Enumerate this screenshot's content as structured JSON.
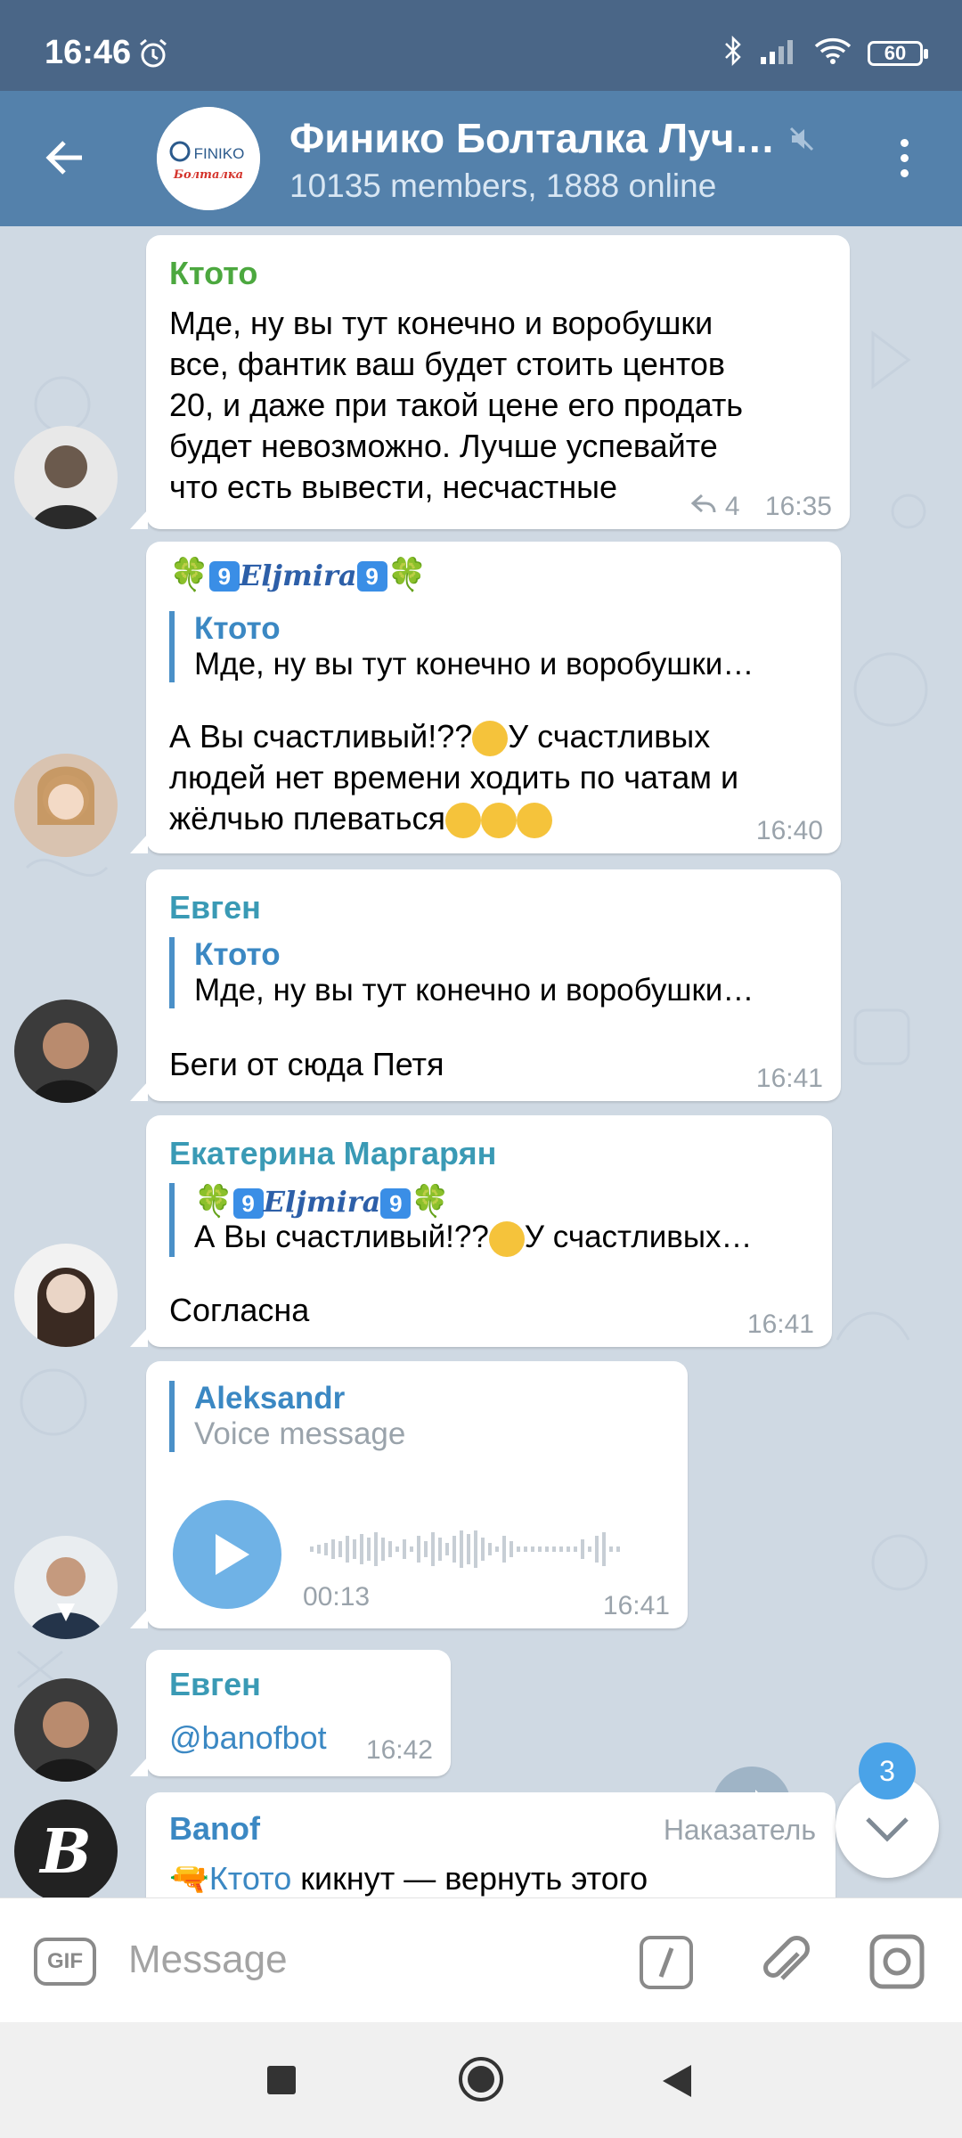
{
  "status_bar": {
    "time": "16:46",
    "battery": "60"
  },
  "header": {
    "title": "Финико Болталка Луч…",
    "subtitle": "10135 members, 1888 online",
    "avatar": {
      "brand": "FINIKO",
      "caption": "Болталка"
    }
  },
  "messages": [
    {
      "sender": "Ктото",
      "text": [
        "Мде, ну вы тут конечно и воробушки",
        "все, фантик ваш будет стоить центов",
        "20, и даже при такой цене его продать",
        "будет невозможно. Лучше успевайте",
        "что есть вывести, несчастные"
      ],
      "replies": "4",
      "time": "16:35"
    },
    {
      "sender_name": "Eljmira",
      "sender_number": "9",
      "reply_to": {
        "name": "Ктото",
        "text": "Мде, ну вы тут конечно и воробушки…"
      },
      "text": [
        "А Вы счастливый!??",
        "У счастливых",
        "людей нет времени ходить по чатам и",
        "жёлчью плеваться"
      ],
      "time": "16:40"
    },
    {
      "sender": "Евген",
      "reply_to": {
        "name": "Ктото",
        "text": "Мде, ну вы тут конечно и воробушки…"
      },
      "text": "Беги от сюда Петя",
      "time": "16:41"
    },
    {
      "sender": "Екатерина Маргарян",
      "reply_to": {
        "name": "Eljmira",
        "number": "9",
        "text": "А Вы счастливый!??",
        "text_tail": "У счастливых…"
      },
      "text": "Согласна",
      "time": "16:41"
    },
    {
      "reply_to": {
        "name": "Aleksandr",
        "text": "Voice message"
      },
      "voice_duration": "00:13",
      "time": "16:41"
    },
    {
      "sender": "Евген",
      "text": "@banofbot",
      "time": "16:42"
    },
    {
      "sender": "Banof",
      "badge": "Наказатель",
      "mention": "Ктото",
      "text": " кикнут — вернуть этого"
    }
  ],
  "unread_count": "3",
  "input": {
    "placeholder": "Message",
    "gif_label": "GIF"
  },
  "colors": {
    "header_bg": "#5481ab",
    "status_bg": "#4a6687",
    "green_name": "#4ca83f",
    "blue_name": "#3b88c3",
    "teal_name": "#3a9ab5"
  }
}
